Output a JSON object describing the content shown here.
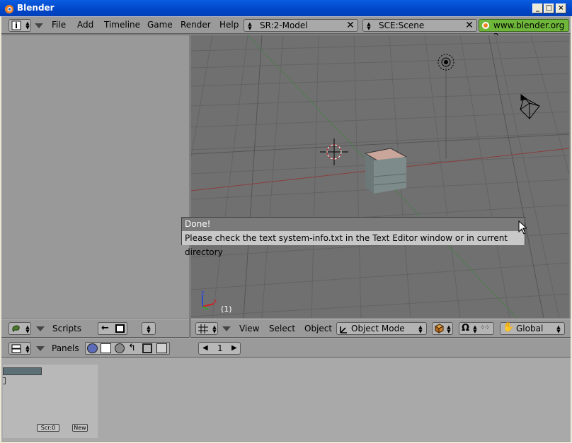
{
  "window": {
    "title": "Blender"
  },
  "top_header": {
    "menus": [
      "File",
      "Add",
      "Timeline",
      "Game",
      "Render",
      "Help"
    ],
    "screen": "SR:2-Model",
    "scene": "SCE:Scene",
    "website": "www.blender.org 2"
  },
  "popup": {
    "title": "Done!",
    "message": "Please check the text system-info.txt in the Text Editor window or in current directory"
  },
  "viewport": {
    "frame_label": "(1)",
    "axis_x": "x",
    "axis_z": "z"
  },
  "left_header": {
    "menu": "Scripts"
  },
  "view3d_header": {
    "menus": [
      "View",
      "Select",
      "Object"
    ],
    "mode": "Object Mode",
    "orientation": "Global"
  },
  "buttons_header": {
    "label": "Panels",
    "frame": "1"
  },
  "bottom_panel": {
    "scr_button": "Scr:0",
    "new_button": "New"
  }
}
